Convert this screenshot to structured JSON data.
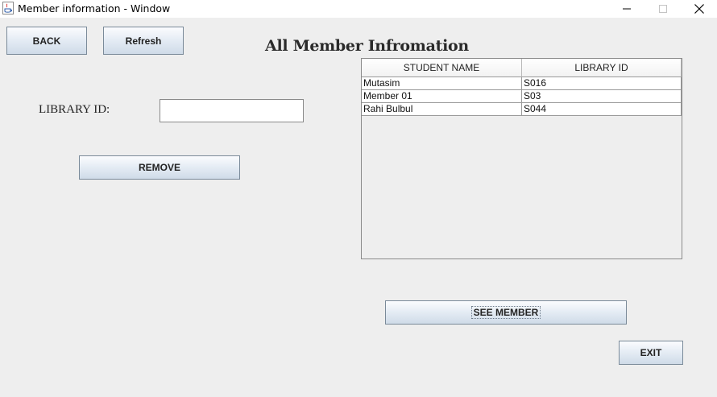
{
  "window": {
    "title": "Member information - Window"
  },
  "toolbar": {
    "back_label": "BACK",
    "refresh_label": "Refresh"
  },
  "heading": "All Member Infromation",
  "form": {
    "library_id_label": "LIBRARY ID:",
    "library_id_value": "",
    "remove_label": "REMOVE"
  },
  "table": {
    "columns": [
      "STUDENT NAME",
      "LIBRARY ID"
    ],
    "rows": [
      [
        "Mutasim",
        "S016"
      ],
      [
        "Member 01",
        "S03"
      ],
      [
        "Rahi Bulbul",
        "S044"
      ]
    ]
  },
  "actions": {
    "see_member_label": "SEE MEMBER",
    "exit_label": "EXIT"
  },
  "icons": {
    "app": "java-cup-icon",
    "minimize": "minimize-icon",
    "maximize": "maximize-icon",
    "close": "close-icon"
  }
}
